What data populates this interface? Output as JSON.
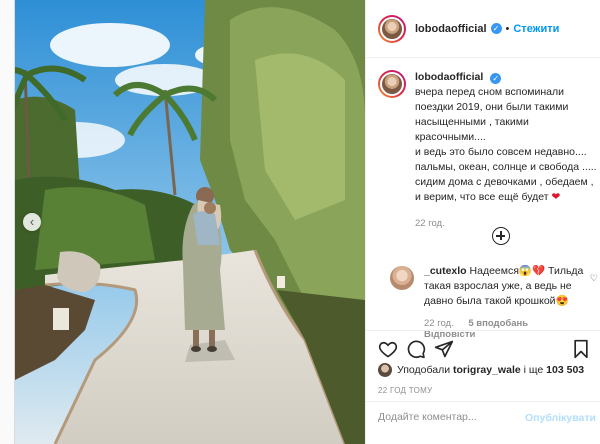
{
  "header": {
    "username": "lobodaofficial",
    "separator": "•",
    "follow_label": "Стежити"
  },
  "caption": {
    "username": "lobodaofficial",
    "lines": [
      "вчера перед сном вспоминали",
      "поездки 2019, они были такими",
      "насыщенными , такими",
      "красочными....",
      "и ведь это было совсем недавно....",
      "пальмы, океан, солнце и свобода .....",
      "сидим дома с девочками , обедаем ,",
      "и верим, что все ещё будет"
    ],
    "emoji": "❤",
    "time": "22 год."
  },
  "comment": {
    "username": "_cutexlo",
    "text_1": "Надеемся",
    "emoji_1": "😱💔",
    "text_2": "Тильда такая взрослая уже, а ведь не давно была такой крошкой",
    "emoji_2": "😍",
    "time": "22 год.",
    "likes": "5 вподобань",
    "reply": "Відповісти"
  },
  "likes": {
    "prefix": "Уподобали",
    "user": "torigray_wale",
    "conjunction": "і ще",
    "count": "103 503"
  },
  "post_time": "22 ГОД ТОМУ",
  "add_comment": {
    "placeholder": "Додайте коментар...",
    "publish_label": "Опублікувати"
  },
  "icons": [
    "chevron-left-icon",
    "verified-icon",
    "add-icon",
    "heart-icon",
    "comment-icon",
    "share-icon",
    "bookmark-icon"
  ],
  "colors": {
    "accent": "#0095f6",
    "verified": "#3897f0",
    "muted": "#8e8e8e",
    "publish_disabled": "#b2dffc"
  }
}
